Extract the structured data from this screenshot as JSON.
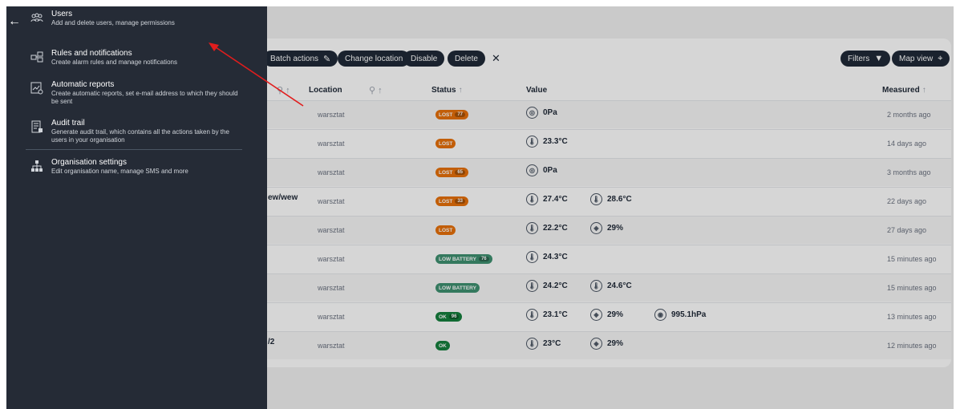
{
  "menu": {
    "back_icon": "arrow-left-icon",
    "items": [
      {
        "title": "Users",
        "desc": "Add and delete users, manage permissions",
        "icon": "users-icon"
      },
      {
        "title": "Rules and notifications",
        "desc": "Create alarm rules and manage notifications",
        "icon": "rules-icon"
      },
      {
        "title": "Automatic reports",
        "desc": "Create automatic reports, set e-mail address to which they should be sent",
        "icon": "report-icon"
      },
      {
        "title": "Audit trail",
        "desc": "Generate audit trail, which contains all the actions taken by the users in your organisation",
        "icon": "audit-icon"
      },
      {
        "title": "Organisation settings",
        "desc": "Edit organisation name, manage SMS and more",
        "icon": "org-chart-icon"
      }
    ]
  },
  "toolbar": {
    "batch_actions": "Batch actions",
    "change_location": "Change location",
    "disable": "Disable",
    "delete": "Delete",
    "close": "✕",
    "filters": "Filters",
    "map_view": "Map view"
  },
  "table": {
    "headers": {
      "location": "Location",
      "status": "Status",
      "value": "Value",
      "measured": "Measured"
    },
    "rows": [
      {
        "name": "",
        "location": "warsztat",
        "status": "LOST",
        "status_num": "77",
        "status_kind": "lost",
        "values": [
          {
            "icon": "pressure-icon",
            "text": "0Pa"
          }
        ],
        "measured": "2 months ago"
      },
      {
        "name": "",
        "location": "warsztat",
        "status": "LOST",
        "status_num": "",
        "status_kind": "lost",
        "values": [
          {
            "icon": "thermometer-icon",
            "text": "23.3°C"
          }
        ],
        "measured": "14 days ago"
      },
      {
        "name": "",
        "location": "warsztat",
        "status": "LOST",
        "status_num": "65",
        "status_kind": "lost",
        "values": [
          {
            "icon": "pressure-icon",
            "text": "0Pa"
          }
        ],
        "measured": "3 months ago"
      },
      {
        "name": "ew/wew",
        "location": "warsztat",
        "status": "LOST",
        "status_num": "33",
        "status_kind": "lost",
        "values": [
          {
            "icon": "thermometer-icon",
            "text": "27.4°C"
          },
          {
            "icon": "thermometer-icon",
            "text": "28.6°C"
          }
        ],
        "measured": "22 days ago"
      },
      {
        "name": "",
        "location": "warsztat",
        "status": "LOST",
        "status_num": "",
        "status_kind": "lost",
        "values": [
          {
            "icon": "thermometer-icon",
            "text": "22.2°C"
          },
          {
            "icon": "humidity-icon",
            "text": "29%"
          }
        ],
        "measured": "27 days ago"
      },
      {
        "name": "",
        "location": "warsztat",
        "status": "LOW BATTERY",
        "status_num": "76",
        "status_kind": "low",
        "values": [
          {
            "icon": "thermometer-icon",
            "text": "24.3°C"
          }
        ],
        "measured": "15 minutes ago"
      },
      {
        "name": "",
        "location": "warsztat",
        "status": "LOW BATTERY",
        "status_num": "",
        "status_kind": "low",
        "values": [
          {
            "icon": "thermometer-icon",
            "text": "24.2°C"
          },
          {
            "icon": "thermometer-icon",
            "text": "24.6°C"
          }
        ],
        "measured": "15 minutes ago"
      },
      {
        "name": "",
        "location": "warsztat",
        "status": "OK",
        "status_num": "96",
        "status_kind": "ok",
        "values": [
          {
            "icon": "thermometer-icon",
            "text": "23.1°C"
          },
          {
            "icon": "humidity-icon",
            "text": "29%"
          },
          {
            "icon": "barometer-icon",
            "text": "995.1hPa"
          }
        ],
        "measured": "13 minutes ago"
      },
      {
        "name": "/2",
        "location": "warsztat",
        "status": "OK",
        "status_num": "",
        "status_kind": "ok",
        "values": [
          {
            "icon": "thermometer-icon",
            "text": "23°C"
          },
          {
            "icon": "humidity-icon",
            "text": "29%"
          }
        ],
        "measured": "12 minutes ago"
      }
    ]
  },
  "colors": {
    "menu_bg": "#252b36",
    "lost": "#e8710a",
    "low_battery": "#3f9170",
    "ok": "#15803d",
    "annotation_arrow": "#e11d1d"
  }
}
